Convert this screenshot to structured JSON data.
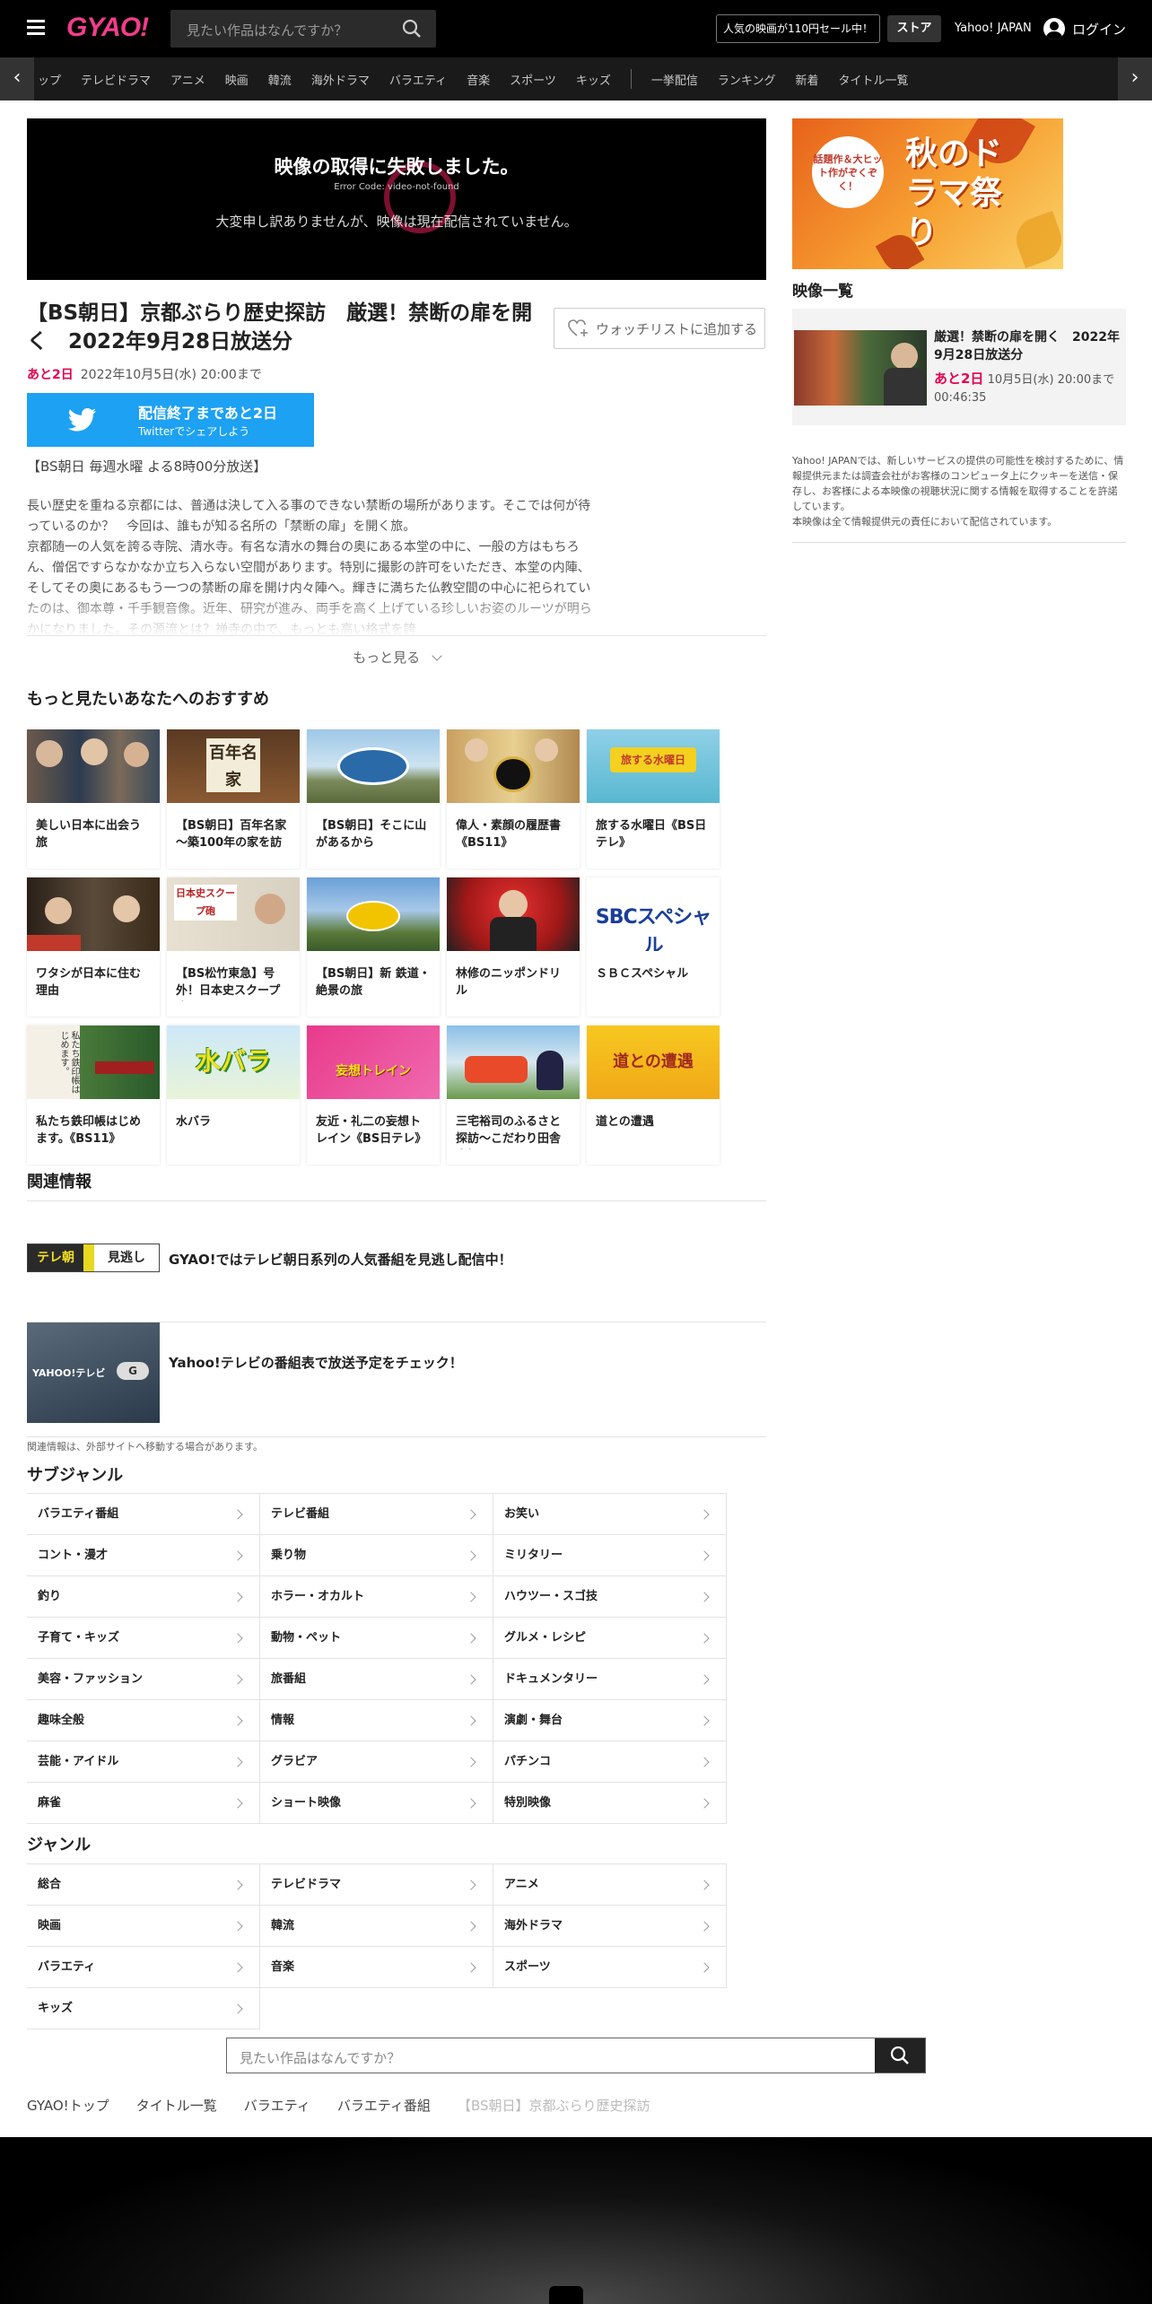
{
  "header": {
    "logo": "GYAO!",
    "search_placeholder": "見たい作品はなんですか？",
    "promo": "人気の映画が110円セール中！",
    "store": "ストア",
    "yahoo_japan": "Yahoo! JAPAN",
    "login": "ログイン"
  },
  "nav": {
    "items": [
      "ップ",
      "テレビドラマ",
      "アニメ",
      "映画",
      "韓流",
      "海外ドラマ",
      "バラエティ",
      "音楽",
      "スポーツ",
      "キッズ"
    ],
    "items2": [
      "一挙配信",
      "ランキング",
      "新着",
      "タイトル一覧"
    ]
  },
  "player": {
    "error_title": "映像の取得に失敗しました。",
    "error_code": "Error Code: video-not-found",
    "error_message": "大変申し訳ありませんが、映像は現在配信されていません。"
  },
  "program": {
    "title": "【BS朝日】京都ぶらり歴史探訪　厳選！禁断の扉を開く　2022年9月28日放送分",
    "watchlist": "ウォッチリストに追加する",
    "remain": "あと2日",
    "until": "2022年10月5日(水) 20:00まで",
    "twitter_line1": "配信終了まであと2日",
    "twitter_line2": "Twitterでシェアしよう",
    "airtime": "【BS朝日 毎週水曜 よる8時00分放送】",
    "description": "長い歴史を重ねる京都には、普通は決して入る事のできない禁断の場所があります。そこでは何が待っているのか？　今回は、誰もが知る名所の「禁断の扉」を開く旅。\n京都随一の人気を誇る寺院、清水寺。有名な清水の舞台の奥にある本堂の中に、一般の方はもちろん、僧侶ですらなかなか立ち入らない空間があります。特別に撮影の許可をいただき、本堂の内陣、そしてその奥にあるもう一つの禁断の扉を開け内々陣へ。輝きに満ちた仏教空間の中心に祀られていたのは、御本尊・千手観音像。近年、研究が進み、両手を高く上げている珍しいお姿のルーツが明らかになりました。その源流とは？禅寺の中で、もっとも高い格式を誇",
    "more": "もっと見る"
  },
  "recommend": {
    "heading": "もっと見たいあなたへのおすすめ",
    "items": [
      {
        "title": "美しい日本に出会う旅"
      },
      {
        "title": "【BS朝日】百年名家～築100年の家を訪ね"
      },
      {
        "title": "【BS朝日】そこに山があるから"
      },
      {
        "title": "偉人・素顔の履歴書《BS11》"
      },
      {
        "title": "旅する水曜日《BS日テレ》"
      },
      {
        "title": "ワタシが日本に住む理由"
      },
      {
        "title": "【BS松竹東急】号外！日本史スクープ砲"
      },
      {
        "title": "【BS朝日】新 鉄道・絶景の旅"
      },
      {
        "title": "林修のニッポンドリル"
      },
      {
        "title": "ＳＢＣスペシャル"
      },
      {
        "title": "私たち鉄印帳はじめます。《BS11》"
      },
      {
        "title": "水バラ"
      },
      {
        "title": "友近・礼二の妄想トレイン《BS日テレ》"
      },
      {
        "title": "三宅裕司のふるさと探訪～こだわり田舎自慢"
      },
      {
        "title": "道との遭遇"
      }
    ],
    "thumb_texts": {
      "hyakunen": "百年名家",
      "suiyobi": "旅する水曜日",
      "sbc": "SBCスペシャル",
      "mizubara": "水バラ",
      "train": "妄想トレイン",
      "michi": "道との遭遇",
      "tetsuin": "私たち鉄印帳はじめます。",
      "nihonshi": "日本史スクープ砲"
    }
  },
  "related": {
    "heading": "関連情報",
    "items": [
      {
        "text": "GYAO!ではテレビ朝日系列の人気番組を見逃し配信中！",
        "logo1": "テレ朝",
        "logo2": "見逃し"
      },
      {
        "text": "Yahoo!テレビの番組表で放送予定をチェック！",
        "logo1": "YAHOO!テレビ",
        "logo2": "G"
      }
    ],
    "note": "関連情報は、外部サイトへ移動する場合があります。"
  },
  "subgenre": {
    "heading": "サブジャンル",
    "items": [
      "バラエティ番組",
      "テレビ番組",
      "お笑い",
      "コント・漫才",
      "乗り物",
      "ミリタリー",
      "釣り",
      "ホラー・オカルト",
      "ハウツー・スゴ技",
      "子育て・キッズ",
      "動物・ペット",
      "グルメ・レシピ",
      "美容・ファッション",
      "旅番組",
      "ドキュメンタリー",
      "趣味全般",
      "情報",
      "演劇・舞台",
      "芸能・アイドル",
      "グラビア",
      "パチンコ",
      "麻雀",
      "ショート映像",
      "特別映像"
    ]
  },
  "genre": {
    "heading": "ジャンル",
    "items": [
      "総合",
      "テレビドラマ",
      "アニメ",
      "映画",
      "韓流",
      "海外ドラマ",
      "バラエティ",
      "音楽",
      "スポーツ",
      "キッズ"
    ]
  },
  "bottom_search": {
    "placeholder": "見たい作品はなんですか？"
  },
  "breadcrumbs": [
    "GYAO!トップ",
    "タイトル一覧",
    "バラエティ",
    "バラエティ番組",
    "【BS朝日】京都ぶらり歴史探訪"
  ],
  "sidebar": {
    "banner_badge": "話題作＆大ヒット作がぞくぞく！",
    "banner_title": "秋のドラマ祭り",
    "episode_heading": "映像一覧",
    "episode": {
      "title": "厳選！禁断の扉を開く　2022年9月28日放送分",
      "remain": "あと2日",
      "until": "10月5日(水) 20:00まで",
      "duration": "00:46:35"
    },
    "disclaimer": "Yahoo! JAPANでは、新しいサービスの提供の可能性を検討するために、情報提供元または調査会社がお客様のコンピュータ上にクッキーを送信・保存し、お客様による本映像の視聴状況に関する情報を取得することを許諾しています。\n本映像は全て情報提供元の責任において配信されています。"
  },
  "colors": {
    "brand": "#f03d8a",
    "accent": "#e5004f",
    "twitter": "#1da1f2"
  }
}
